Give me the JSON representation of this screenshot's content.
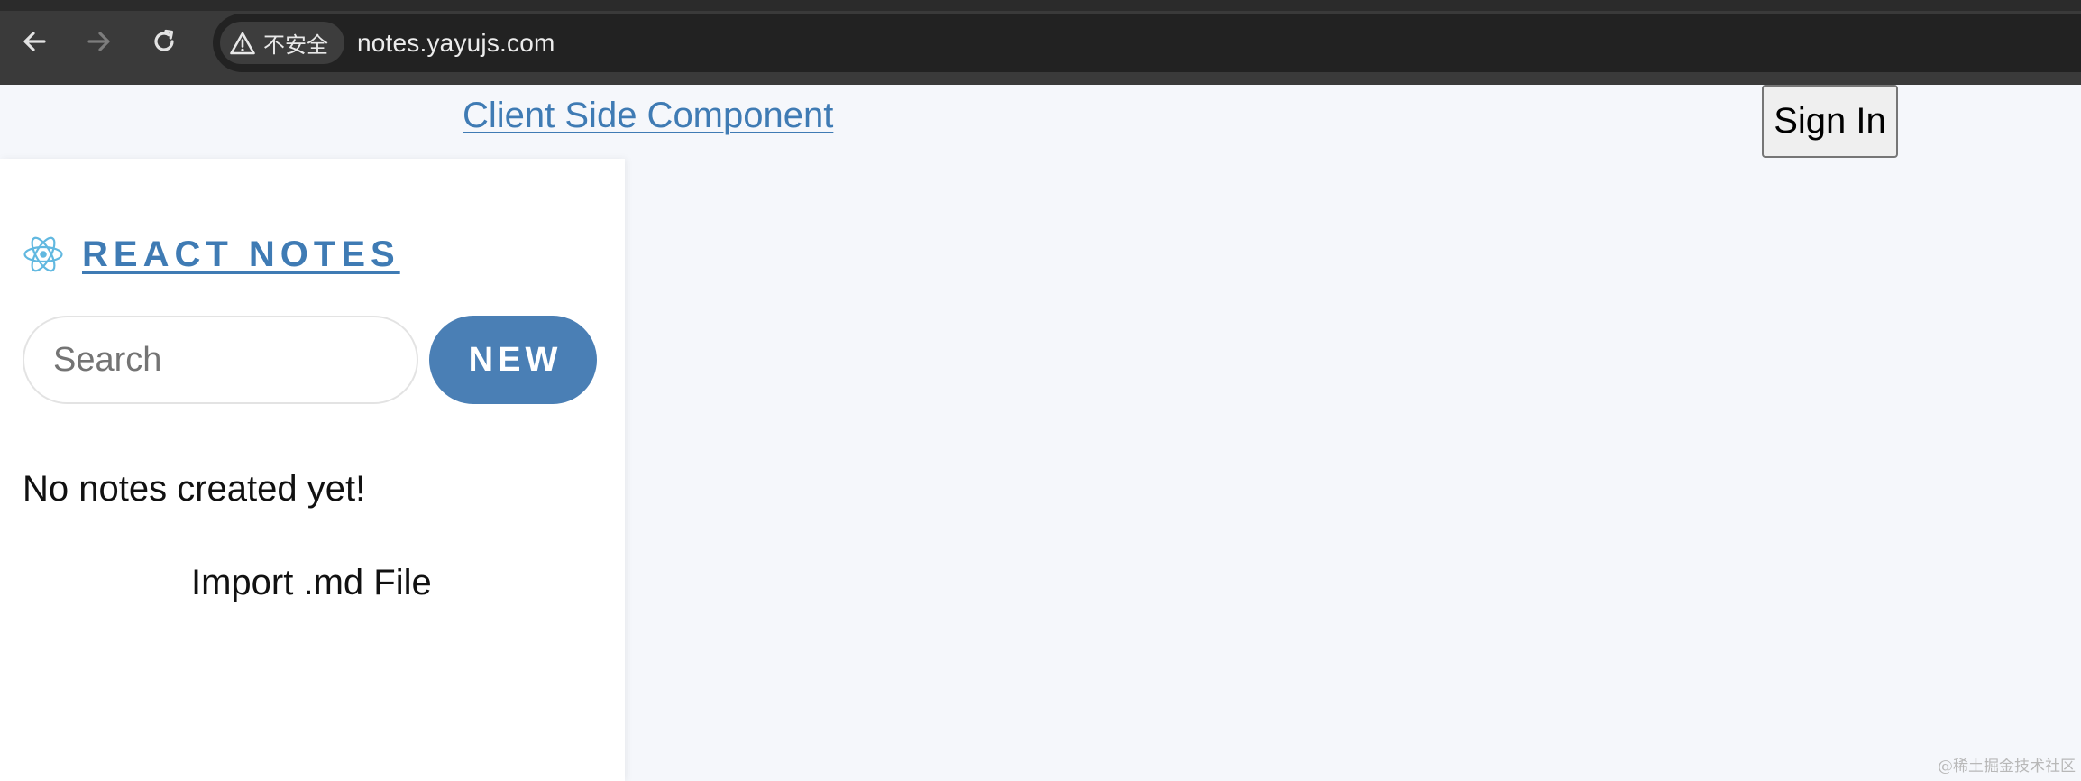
{
  "browser": {
    "nav": {
      "back_icon": "arrow-left-icon",
      "forward_icon": "arrow-right-icon",
      "reload_icon": "reload-icon"
    },
    "security_label": "不安全",
    "security_icon": "warning-triangle-icon",
    "url": "notes.yayujs.com"
  },
  "header": {
    "client_link": "Client Side Component",
    "sign_in_label": "Sign In"
  },
  "sidebar": {
    "brand_icon": "react-logo-icon",
    "brand_title": "REACT NOTES",
    "search_placeholder": "Search",
    "search_value": "",
    "new_label": "NEW",
    "empty_message": "No notes created yet!",
    "import_label": "Import .md File"
  },
  "watermark": "@稀土掘金技术社区",
  "colors": {
    "accent": "#4a7fb5",
    "link": "#3f7bb4",
    "page_bg": "#f5f7fb",
    "sidebar_bg": "#ffffff",
    "chrome_bg": "#3a3a3a",
    "omnibox_bg": "#222222"
  }
}
